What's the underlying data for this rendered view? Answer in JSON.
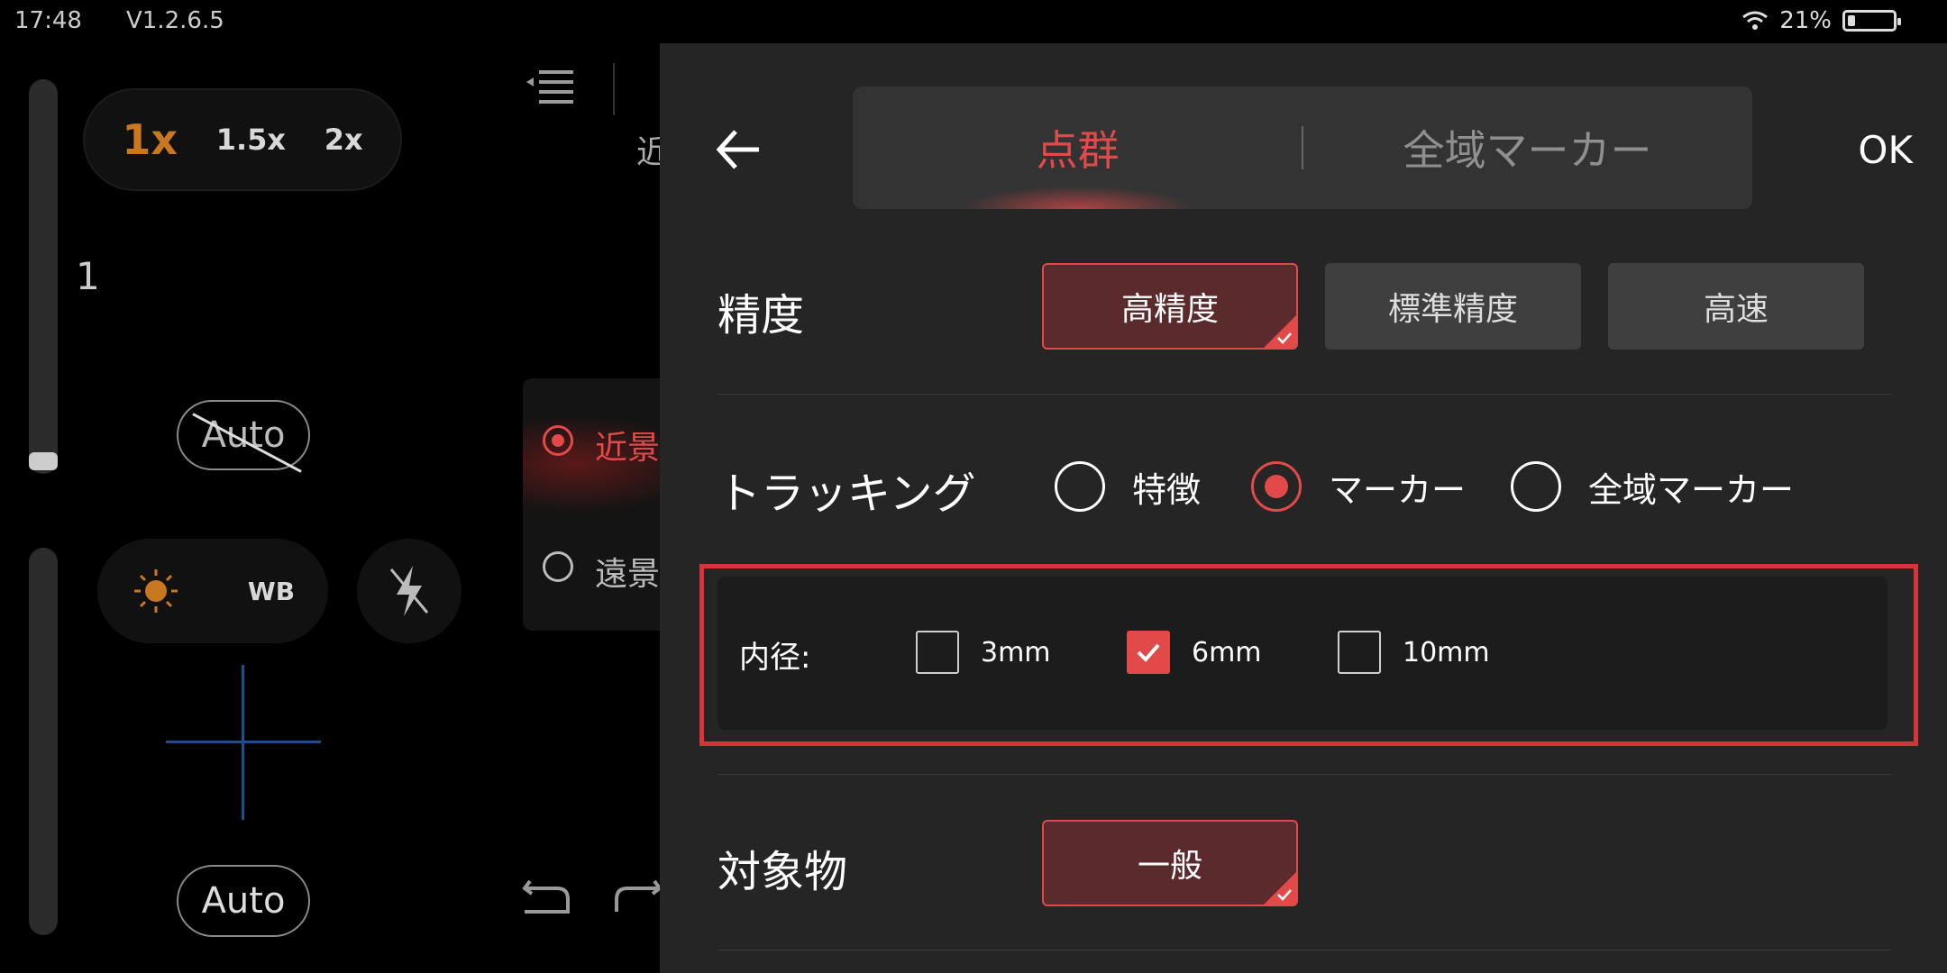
{
  "status_bar": {
    "time": "17:48",
    "version": "V1.2.6.5",
    "battery": "21%"
  },
  "camera": {
    "zoom_options": [
      "1x",
      "1.5x",
      "2x"
    ],
    "zoom_selected": "1x",
    "iso_value": "1",
    "auto_top_label": "Auto",
    "wb_label": "WB",
    "auto_bottom_label": "Auto",
    "accent_color": "#c9781f"
  },
  "background_panel": {
    "top_label": "近",
    "options": [
      "近景",
      "遠景"
    ],
    "selected": "近景"
  },
  "settings": {
    "tabs": [
      "点群",
      "全域マーカー"
    ],
    "active_tab": "点群",
    "ok_label": "OK",
    "precision": {
      "label": "精度",
      "options": [
        "高精度",
        "標準精度",
        "高速"
      ],
      "selected": "高精度"
    },
    "tracking": {
      "label": "トラッキング",
      "options": [
        "特徴",
        "マーカー",
        "全域マーカー"
      ],
      "selected": "マーカー"
    },
    "inner_diameter": {
      "label": "内径:",
      "options": [
        "3mm",
        "6mm",
        "10mm"
      ],
      "selected": "6mm"
    },
    "target": {
      "label": "対象物",
      "options": [
        "一般"
      ],
      "selected": "一般"
    },
    "accent_color": "#e24a4a"
  }
}
